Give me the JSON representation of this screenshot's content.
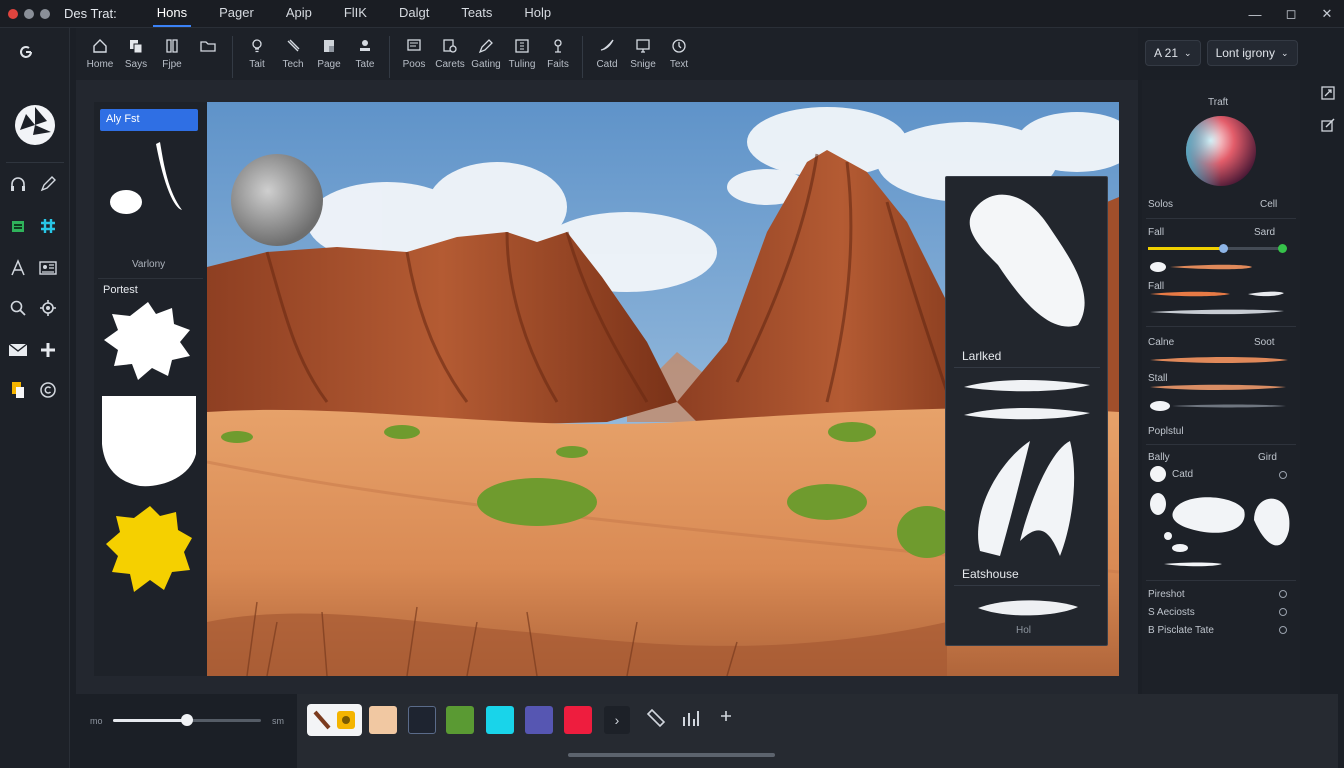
{
  "app": {
    "title": "Des Trat:",
    "traffic_colors": [
      "#e0443e",
      "#8a8f98",
      "#8a8f98"
    ]
  },
  "menu": [
    {
      "label": "Hons",
      "active": true
    },
    {
      "label": "Pager"
    },
    {
      "label": "Apip"
    },
    {
      "label": "FlIK"
    },
    {
      "label": "Dalgt"
    },
    {
      "label": "Teats"
    },
    {
      "label": "Holp"
    }
  ],
  "ribbon": {
    "groups": [
      [
        {
          "icon": "home-icon",
          "label": "Home"
        },
        {
          "icon": "copy-icon",
          "label": "Says"
        },
        {
          "icon": "book-icon",
          "label": "Fjpe"
        },
        {
          "icon": "folder-icon",
          "label": ""
        }
      ],
      [
        {
          "icon": "bulb-icon",
          "label": "Tait"
        },
        {
          "icon": "pen-icon",
          "label": "Tech"
        },
        {
          "icon": "page-icon",
          "label": "Page"
        },
        {
          "icon": "stamp-icon",
          "label": "Tate"
        }
      ],
      [
        {
          "icon": "panel-icon",
          "label": "Poos"
        },
        {
          "icon": "search-doc-icon",
          "label": "Carets"
        },
        {
          "icon": "pencil-icon",
          "label": "Gating"
        },
        {
          "icon": "grid-icon",
          "label": "Tuling"
        },
        {
          "icon": "marker-icon",
          "label": "Faits"
        }
      ],
      [
        {
          "icon": "brush-icon",
          "label": "Catd"
        },
        {
          "icon": "monitor-icon",
          "label": "Snige"
        },
        {
          "icon": "clock-icon",
          "label": "Text"
        }
      ]
    ]
  },
  "right_tools": {
    "font_chip": "A 21",
    "dropdown": "Lont igrony"
  },
  "left_panel": {
    "header": "Aly Fst",
    "caption1": "Varlony",
    "section": "Portest"
  },
  "brush_panel": {
    "caption1": "Larlked",
    "caption2": "Eatshouse",
    "caption3": "Hol"
  },
  "props": {
    "title": "Traft",
    "row_solor": [
      "Solos",
      "Cell"
    ],
    "row_fall": [
      "Fall",
      "Sard"
    ],
    "row_fall2": "Fall",
    "row_calne": [
      "Calne",
      "Soot"
    ],
    "row_stall": "Stall",
    "row_poplstul": "Poplstul",
    "row_bally": [
      "Bally",
      "Gird"
    ],
    "row_cated": "Catd",
    "options": [
      "Pireshot",
      "S Aeciosts",
      "B Pisclate Tate"
    ],
    "slider_value": 0.55
  },
  "bottom": {
    "zoom_min": "mo",
    "zoom_max": "sm",
    "zoom_value": 0.5,
    "swatches": [
      "#f1c8a2",
      "#1e2430",
      "#5a9a33",
      "#19d4ea",
      "#5656b2",
      "#ee1d3e"
    ],
    "active_tool_colors": [
      "#f4b400",
      "#7b3b1f"
    ]
  }
}
